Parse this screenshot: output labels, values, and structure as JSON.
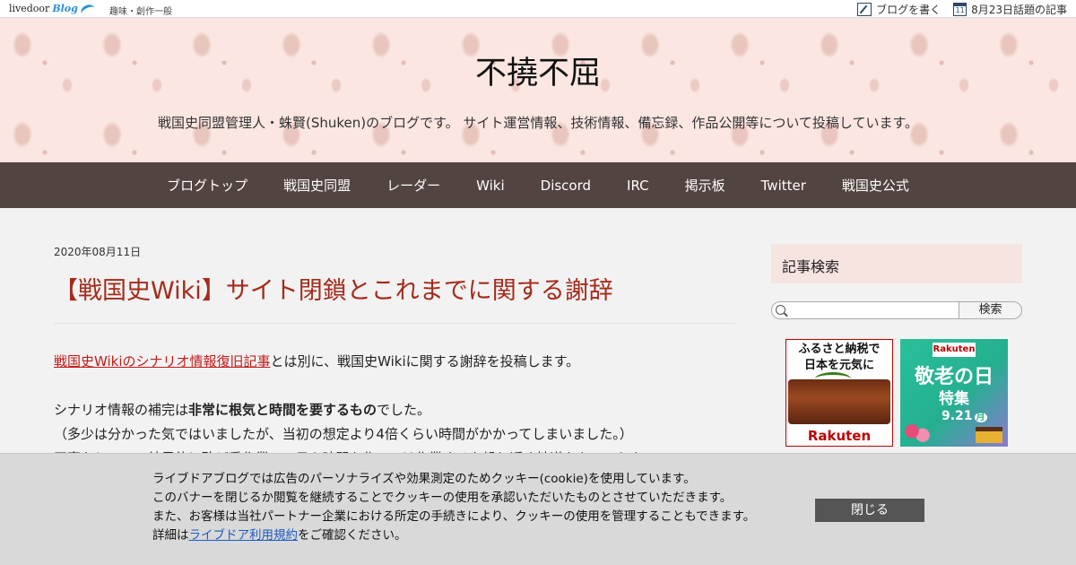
{
  "topbar": {
    "logo_text": "livedoor",
    "logo_blog": "Blog",
    "category": "趣味・創作一般",
    "write_blog": "ブログを書く",
    "calendar_day": "11",
    "trending": "8月23日話題の記事"
  },
  "header": {
    "title": "不撓不屈",
    "description": "戦国史同盟管理人・蛛賢(Shuken)のブログです。 サイト運営情報、技術情報、備忘録、作品公開等について投稿しています。"
  },
  "nav": {
    "items": [
      "ブログトップ",
      "戦国史同盟",
      "レーダー",
      "Wiki",
      "Discord",
      "IRC",
      "掲示板",
      "Twitter",
      "戦国史公式"
    ]
  },
  "post": {
    "date": "2020年08月11日",
    "title": "【戦国史Wiki】サイト閉鎖とこれまでに関する謝辞",
    "link_text": "戦国史Wikiのシナリオ情報復旧記事",
    "p1_rest": "とは別に、戦国史Wikiに関する謝辞を投稿します。",
    "p2_pre": "シナリオ情報の補完は",
    "p2_bold": "非常に根気と時間を要するもの",
    "p2_post": "でした。",
    "p3": "（多少は分かった気ではいましたが、当初の想定より4倍くらい時間がかかってしまいました。）",
    "p4": "正直なところ、結果的に殆ど手作業で、日々時間を作っては作業するを繰り返す地道なものでした。"
  },
  "sidebar": {
    "search_title": "記事検索",
    "search_placeholder": "",
    "search_button": "検索",
    "ad1": {
      "line1": "ふるさと納税で",
      "line2": "日本を元気に",
      "brand": "Rakuten"
    },
    "ad2": {
      "brand": "Rakuten",
      "line1": "敬老の日",
      "line2": "特集",
      "date": "9.21",
      "day": "月"
    }
  },
  "cookie": {
    "line1": "ライブドアブログでは広告のパーソナライズや効果測定のためクッキー(cookie)を使用しています。",
    "line2": "このバナーを閉じるか閲覧を継続することでクッキーの使用を承認いただいたものとさせていただきます。",
    "line3": "また、お客様は当社パートナー企業における所定の手続きにより、クッキーの使用を管理することもできます。",
    "line4_pre": "詳細は",
    "line4_link": "ライブドア利用規約",
    "line4_post": "をご確認ください。",
    "close_label": "閉じる"
  }
}
